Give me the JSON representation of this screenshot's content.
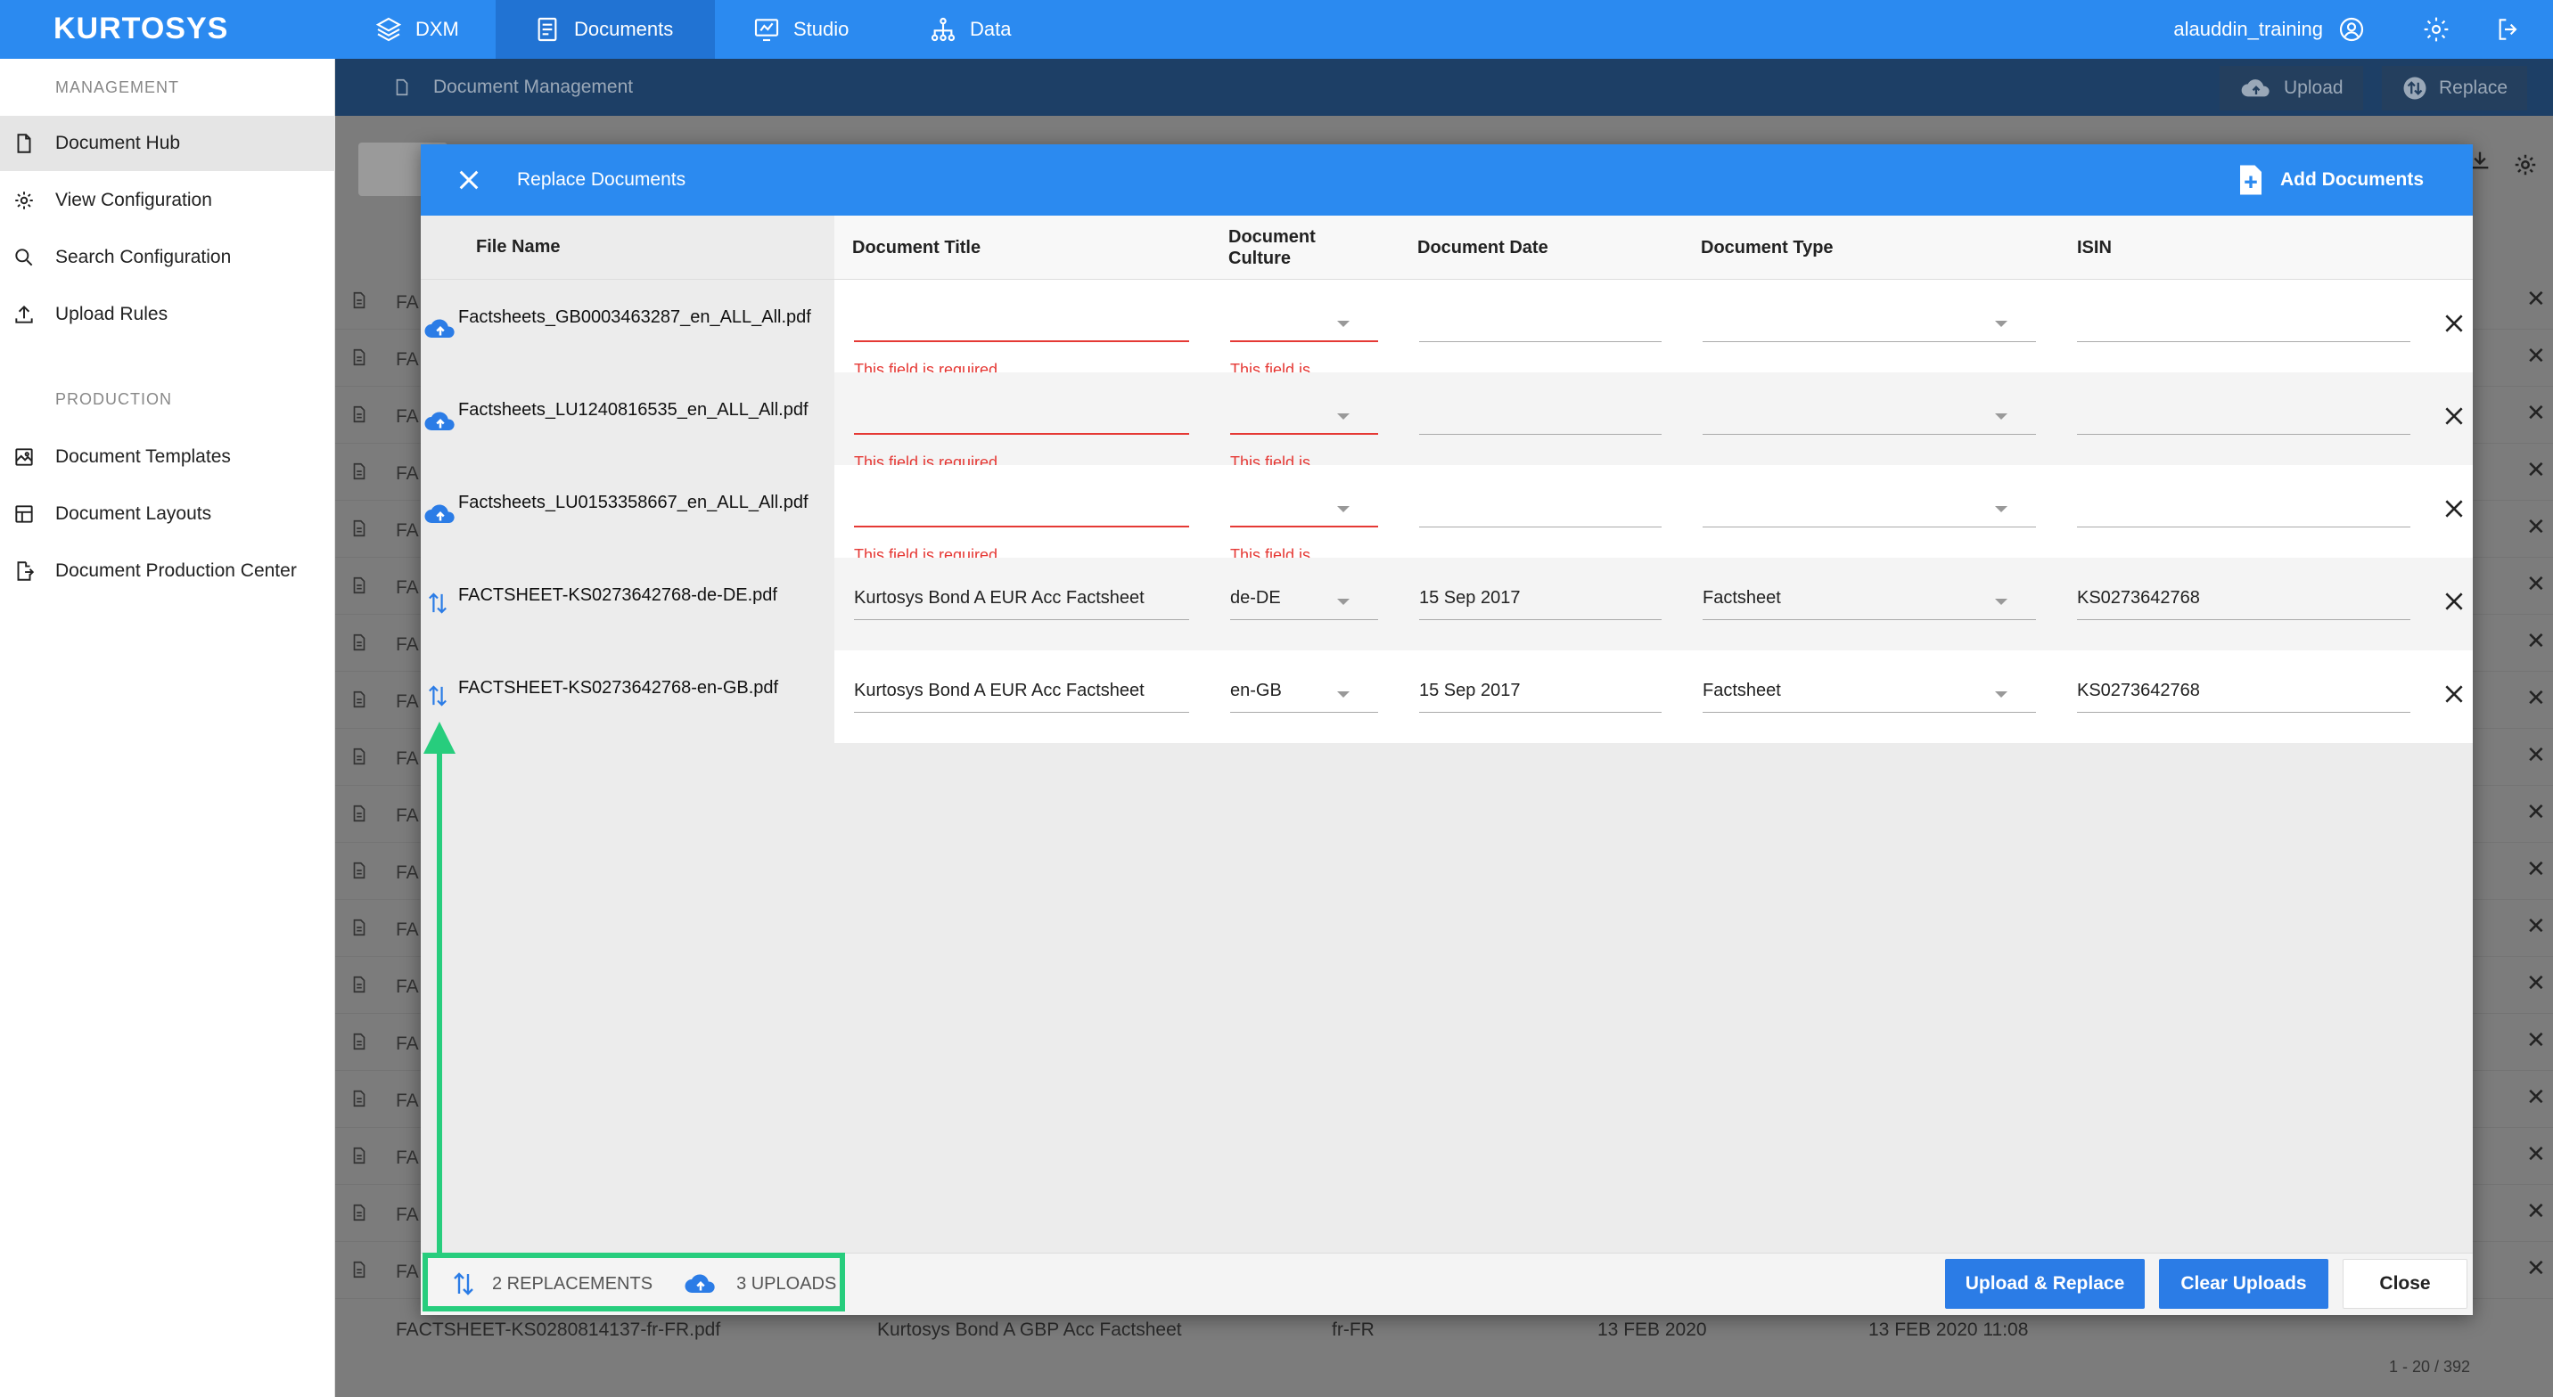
{
  "topnav": {
    "logo": "KURTOSYS",
    "items": [
      {
        "label": "DXM",
        "icon": "layers-icon"
      },
      {
        "label": "Documents",
        "icon": "documents-icon",
        "active": true
      },
      {
        "label": "Studio",
        "icon": "studio-icon"
      },
      {
        "label": "Data",
        "icon": "data-icon"
      }
    ],
    "username": "alauddin_training",
    "accent": "#2b8af0"
  },
  "sidebar": {
    "sections": [
      {
        "title": "MANAGEMENT",
        "items": [
          "Document Hub",
          "View Configuration",
          "Search Configuration",
          "Upload Rules"
        ]
      },
      {
        "title": "PRODUCTION",
        "items": [
          "Document Templates",
          "Document Layouts",
          "Document Production Center"
        ]
      }
    ]
  },
  "subbar": {
    "title": "Document Management",
    "upload_label": "Upload",
    "replace_label": "Replace"
  },
  "background": {
    "row_prefix": "FA",
    "last_row": [
      "FACTSHEET-KS0280814137-fr-FR.pdf",
      "Kurtosys Bond A GBP Acc Factsheet",
      "fr-FR",
      "13 FEB 2020",
      "13 FEB 2020 11:08"
    ],
    "pager": "1 - 20 / 392"
  },
  "modal": {
    "title": "Replace Documents",
    "add_documents_label": "Add Documents",
    "columns": {
      "file_name": "File Name",
      "title": "Document Title",
      "culture": "Document Culture",
      "date": "Document Date",
      "type": "Document Type",
      "isin": "ISIN"
    },
    "rows": [
      {
        "kind": "upload",
        "file": "Factsheets_GB0003463287_en_ALL_All.pdf",
        "title": "",
        "culture": "",
        "date": "",
        "type": "",
        "isin": "",
        "title_error": "This field is required",
        "culture_error": "This field is required"
      },
      {
        "kind": "upload",
        "file": "Factsheets_LU1240816535_en_ALL_All.pdf",
        "title": "",
        "culture": "",
        "date": "",
        "type": "",
        "isin": "",
        "title_error": "This field is required",
        "culture_error": "This field is required"
      },
      {
        "kind": "upload",
        "file": "Factsheets_LU0153358667_en_ALL_All.pdf",
        "title": "",
        "culture": "",
        "date": "",
        "type": "",
        "isin": "",
        "title_error": "This field is required",
        "culture_error": "This field is required"
      },
      {
        "kind": "replace",
        "file": "FACTSHEET-KS0273642768-de-DE.pdf",
        "title": "Kurtosys Bond A EUR Acc Factsheet",
        "culture": "de-DE",
        "date": "15 Sep 2017",
        "type": "Factsheet",
        "isin": "KS0273642768"
      },
      {
        "kind": "replace",
        "file": "FACTSHEET-KS0273642768-en-GB.pdf",
        "title": "Kurtosys Bond A EUR Acc Factsheet",
        "culture": "en-GB",
        "date": "15 Sep 2017",
        "type": "Factsheet",
        "isin": "KS0273642768"
      }
    ],
    "footer": {
      "replacements": "2 REPLACEMENTS",
      "uploads": "3 UPLOADS",
      "upload_replace_label": "Upload & Replace",
      "clear_label": "Clear Uploads",
      "close_label": "Close"
    },
    "annotation_color": "#27cd7d",
    "error_color": "#e53935"
  }
}
